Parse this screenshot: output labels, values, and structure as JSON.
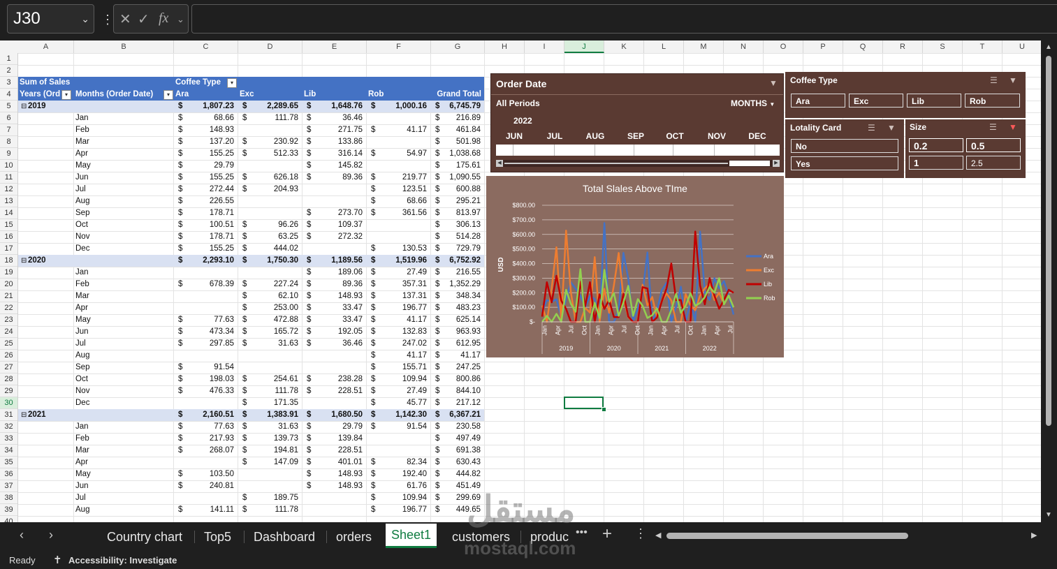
{
  "formula_bar": {
    "name_box": "J30",
    "fx": "fx"
  },
  "columns": [
    "A",
    "B",
    "C",
    "D",
    "E",
    "F",
    "G",
    "H",
    "I",
    "J",
    "K",
    "L",
    "M",
    "N",
    "O",
    "P",
    "Q",
    "R",
    "S",
    "T",
    "U"
  ],
  "selected_column": "J",
  "rows": [
    "1",
    "2",
    "3",
    "4",
    "5",
    "6",
    "7",
    "8",
    "9",
    "10",
    "11",
    "12",
    "13",
    "14",
    "15",
    "16",
    "17",
    "18",
    "19",
    "20",
    "21",
    "22",
    "23",
    "24",
    "25",
    "26",
    "27",
    "28",
    "29",
    "30",
    "31",
    "32",
    "33",
    "34",
    "35",
    "36",
    "37",
    "38",
    "39",
    "40"
  ],
  "selected_row": "30",
  "pivot": {
    "values_label": "Sum of Sales",
    "col_field": "Coffee Type",
    "row_field_1": "Years (Order Date)",
    "row_field_2": "Months (Order Date)",
    "col_headers": [
      "Ara",
      "Exc",
      "Lib",
      "Rob",
      "Grand Total"
    ],
    "currency": "$",
    "rows": [
      {
        "r": 5,
        "year": "2019",
        "vals": [
          "1,807.23",
          "2,289.65",
          "1,648.76",
          "1,000.16",
          "6,745.79"
        ]
      },
      {
        "r": 6,
        "month": "Jan",
        "vals": [
          "68.66",
          "111.78",
          "36.46",
          "",
          "216.89"
        ]
      },
      {
        "r": 7,
        "month": "Feb",
        "vals": [
          "148.93",
          "",
          "271.75",
          "41.17",
          "461.84"
        ]
      },
      {
        "r": 8,
        "month": "Mar",
        "vals": [
          "137.20",
          "230.92",
          "133.86",
          "",
          "501.98"
        ]
      },
      {
        "r": 9,
        "month": "Apr",
        "vals": [
          "155.25",
          "512.33",
          "316.14",
          "54.97",
          "1,038.68"
        ]
      },
      {
        "r": 10,
        "month": "May",
        "vals": [
          "29.79",
          "",
          "145.82",
          "",
          "175.61"
        ]
      },
      {
        "r": 11,
        "month": "Jun",
        "vals": [
          "155.25",
          "626.18",
          "89.36",
          "219.77",
          "1,090.55"
        ]
      },
      {
        "r": 12,
        "month": "Jul",
        "vals": [
          "272.44",
          "204.93",
          "",
          "123.51",
          "600.88"
        ]
      },
      {
        "r": 13,
        "month": "Aug",
        "vals": [
          "226.55",
          "",
          "",
          "68.66",
          "295.21"
        ]
      },
      {
        "r": 14,
        "month": "Sep",
        "vals": [
          "178.71",
          "",
          "273.70",
          "361.56",
          "813.97"
        ]
      },
      {
        "r": 15,
        "month": "Oct",
        "vals": [
          "100.51",
          "96.26",
          "109.37",
          "",
          "306.13"
        ]
      },
      {
        "r": 16,
        "month": "Nov",
        "vals": [
          "178.71",
          "63.25",
          "272.32",
          "",
          "514.28"
        ]
      },
      {
        "r": 17,
        "month": "Dec",
        "vals": [
          "155.25",
          "444.02",
          "",
          "130.53",
          "729.79"
        ]
      },
      {
        "r": 18,
        "year": "2020",
        "vals": [
          "2,293.10",
          "1,750.30",
          "1,189.56",
          "1,519.96",
          "6,752.92"
        ]
      },
      {
        "r": 19,
        "month": "Jan",
        "vals": [
          "",
          "",
          "189.06",
          "27.49",
          "216.55"
        ]
      },
      {
        "r": 20,
        "month": "Feb",
        "vals": [
          "678.39",
          "227.24",
          "89.36",
          "357.31",
          "1,352.29"
        ]
      },
      {
        "r": 21,
        "month": "Mar",
        "vals": [
          "",
          "62.10",
          "148.93",
          "137.31",
          "348.34"
        ]
      },
      {
        "r": 22,
        "month": "Apr",
        "vals": [
          "",
          "253.00",
          "33.47",
          "196.77",
          "483.23"
        ]
      },
      {
        "r": 23,
        "month": "May",
        "vals": [
          "77.63",
          "472.88",
          "33.47",
          "41.17",
          "625.14"
        ]
      },
      {
        "r": 24,
        "month": "Jun",
        "vals": [
          "473.34",
          "165.72",
          "192.05",
          "132.83",
          "963.93"
        ]
      },
      {
        "r": 25,
        "month": "Jul",
        "vals": [
          "297.85",
          "31.63",
          "36.46",
          "247.02",
          "612.95"
        ]
      },
      {
        "r": 26,
        "month": "Aug",
        "vals": [
          "",
          "",
          "",
          "41.17",
          "41.17"
        ]
      },
      {
        "r": 27,
        "month": "Sep",
        "vals": [
          "91.54",
          "",
          "",
          "155.71",
          "247.25"
        ]
      },
      {
        "r": 28,
        "month": "Oct",
        "vals": [
          "198.03",
          "254.61",
          "238.28",
          "109.94",
          "800.86"
        ]
      },
      {
        "r": 29,
        "month": "Nov",
        "vals": [
          "476.33",
          "111.78",
          "228.51",
          "27.49",
          "844.10"
        ]
      },
      {
        "r": 30,
        "month": "Dec",
        "vals": [
          "",
          "171.35",
          "",
          "45.77",
          "217.12"
        ]
      },
      {
        "r": 31,
        "year": "2021",
        "vals": [
          "2,160.51",
          "1,383.91",
          "1,680.50",
          "1,142.30",
          "6,367.21"
        ]
      },
      {
        "r": 32,
        "month": "Jan",
        "vals": [
          "77.63",
          "31.63",
          "29.79",
          "91.54",
          "230.58"
        ]
      },
      {
        "r": 33,
        "month": "Feb",
        "vals": [
          "217.93",
          "139.73",
          "139.84",
          "",
          "497.49"
        ]
      },
      {
        "r": 34,
        "month": "Mar",
        "vals": [
          "268.07",
          "194.81",
          "228.51",
          "",
          "691.38"
        ]
      },
      {
        "r": 35,
        "month": "Apr",
        "vals": [
          "",
          "147.09",
          "401.01",
          "82.34",
          "630.43"
        ]
      },
      {
        "r": 36,
        "month": "May",
        "vals": [
          "103.50",
          "",
          "148.93",
          "192.40",
          "444.82"
        ]
      },
      {
        "r": 37,
        "month": "Jun",
        "vals": [
          "240.81",
          "",
          "148.93",
          "61.76",
          "451.49"
        ]
      },
      {
        "r": 38,
        "month": "Jul",
        "vals": [
          "",
          "189.75",
          "",
          "109.94",
          "299.69"
        ]
      },
      {
        "r": 39,
        "month": "Aug",
        "vals": [
          "141.11",
          "111.78",
          "",
          "196.77",
          "449.65"
        ]
      }
    ]
  },
  "timeline": {
    "title": "Order Date",
    "period_label": "All Periods",
    "level": "MONTHS",
    "year": "2022",
    "months": [
      "JUN",
      "JUL",
      "AUG",
      "SEP",
      "OCT",
      "NOV",
      "DEC"
    ]
  },
  "slicers": {
    "coffee_type": {
      "title": "Coffee Type",
      "items": [
        "Ara",
        "Exc",
        "Lib",
        "Rob"
      ]
    },
    "loyalty_card": {
      "title": "Lotality Card",
      "items": [
        "No",
        "Yes"
      ]
    },
    "size": {
      "title": "Size",
      "items": [
        "0.2",
        "0.5",
        "1",
        "2.5"
      ]
    }
  },
  "chart_data": {
    "type": "line",
    "title": "Total Slales Above TIme",
    "ylabel": "USD",
    "ylim": [
      0,
      800
    ],
    "yticks": [
      "$-",
      "$100.00",
      "$200.00",
      "$300.00",
      "$400.00",
      "$500.00",
      "$600.00",
      "$700.00",
      "$800.00"
    ],
    "year_groups": [
      "2019",
      "2020",
      "2021",
      "2022"
    ],
    "x_tick_labels": [
      "Jan",
      "Apr",
      "Jul",
      "Oct",
      "Jan",
      "Apr",
      "Jul",
      "Oct",
      "Jan",
      "Apr",
      "Jul",
      "Oct",
      "Jan",
      "Apr",
      "Jul"
    ],
    "series": [
      {
        "name": "Ara",
        "color": "#4472c4",
        "values": [
          69,
          149,
          137,
          155,
          30,
          155,
          272,
          227,
          179,
          101,
          179,
          155,
          0,
          678,
          0,
          0,
          78,
          473,
          298,
          0,
          92,
          198,
          476,
          0,
          78,
          218,
          268,
          0,
          104,
          241,
          0,
          141,
          0,
          620,
          200,
          150,
          300,
          230,
          280,
          180,
          50
        ]
      },
      {
        "name": "Exc",
        "color": "#ed7d31",
        "values": [
          112,
          0,
          231,
          512,
          0,
          626,
          205,
          0,
          0,
          96,
          63,
          444,
          0,
          227,
          62,
          253,
          473,
          166,
          32,
          0,
          0,
          255,
          112,
          171,
          32,
          140,
          195,
          147,
          0,
          0,
          190,
          112,
          80,
          180,
          230,
          260,
          150,
          200,
          120,
          180,
          100
        ]
      },
      {
        "name": "Lib",
        "color": "#c00000",
        "values": [
          36,
          272,
          134,
          316,
          146,
          89,
          0,
          0,
          274,
          109,
          272,
          0,
          189,
          89,
          149,
          33,
          33,
          192,
          36,
          0,
          0,
          238,
          229,
          0,
          30,
          140,
          229,
          401,
          149,
          149,
          0,
          0,
          620,
          250,
          120,
          300,
          180,
          90,
          150,
          220,
          200
        ]
      },
      {
        "name": "Rob",
        "color": "#92d050",
        "values": [
          0,
          41,
          0,
          55,
          0,
          220,
          124,
          69,
          362,
          0,
          0,
          131,
          27,
          357,
          137,
          197,
          41,
          133,
          247,
          41,
          156,
          110,
          27,
          46,
          92,
          0,
          0,
          82,
          192,
          62,
          110,
          197,
          110,
          130,
          170,
          240,
          200,
          300,
          120,
          180,
          100
        ]
      }
    ]
  },
  "sheet_tabs": [
    "Country chart",
    "Top5",
    "Dashboard",
    "orders",
    "Sheet1",
    "customers",
    "produc"
  ],
  "active_tab": "Sheet1",
  "status": {
    "ready": "Ready",
    "accessibility": "Accessibility: Investigate"
  },
  "watermark": {
    "arabic": "مستقل",
    "latin": "mostaql.com"
  }
}
